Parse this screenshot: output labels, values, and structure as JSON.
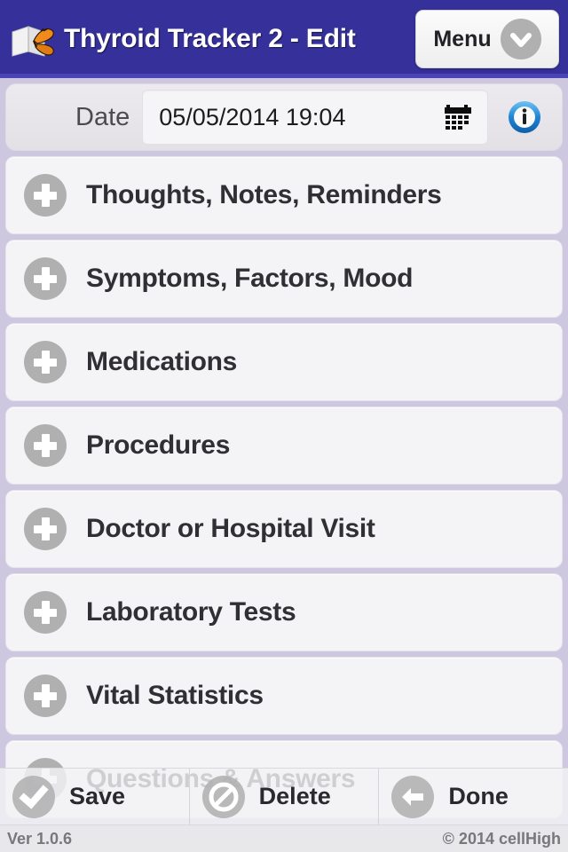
{
  "header": {
    "title": "Thyroid Tracker 2 - Edit",
    "app_icon": "book-butterfly-icon",
    "menu_label": "Menu",
    "menu_chevron_icon": "chevron-down-icon",
    "background_color": "#35309a"
  },
  "date_row": {
    "label": "Date",
    "value": "05/05/2014 19:04",
    "calendar_icon": "calendar-icon",
    "info_icon": "info-circle-icon",
    "info_color": "#1e8fe0"
  },
  "list": {
    "items": [
      {
        "label": "Thoughts, Notes, Reminders",
        "icon": "plus-circle-icon"
      },
      {
        "label": "Symptoms, Factors, Mood",
        "icon": "plus-circle-icon"
      },
      {
        "label": "Medications",
        "icon": "plus-circle-icon"
      },
      {
        "label": "Procedures",
        "icon": "plus-circle-icon"
      },
      {
        "label": "Doctor or Hospital Visit",
        "icon": "plus-circle-icon"
      },
      {
        "label": "Laboratory Tests",
        "icon": "plus-circle-icon"
      },
      {
        "label": "Vital Statistics",
        "icon": "plus-circle-icon"
      },
      {
        "label": "Questions & Answers",
        "icon": "plus-circle-icon"
      }
    ]
  },
  "toolbar": {
    "buttons": [
      {
        "label": "Save",
        "icon": "check-circle-icon"
      },
      {
        "label": "Delete",
        "icon": "no-entry-circle-icon"
      },
      {
        "label": "Done",
        "icon": "arrow-left-circle-icon"
      }
    ]
  },
  "footer": {
    "version": "Ver 1.0.6",
    "copyright": "© 2014 cellHigh"
  }
}
